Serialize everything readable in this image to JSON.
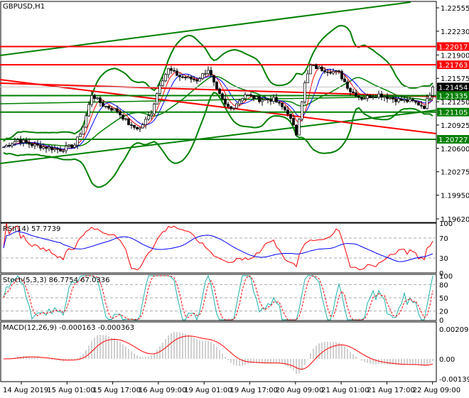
{
  "chart_data": {
    "type": "candlestick",
    "symbol_label": "GBPUSD,H1",
    "price_axis": {
      "ticks": [
        "1.22555",
        "1.22230",
        "1.21900",
        "1.21575",
        "1.21250",
        "1.20925",
        "1.20600",
        "1.20275",
        "1.19950",
        "1.19620"
      ],
      "range": [
        1.1962,
        1.22555
      ]
    },
    "levels": [
      {
        "label": "1.22017",
        "value": 1.22017,
        "color": "#ff0000"
      },
      {
        "label": "1.21763",
        "value": 1.21763,
        "color": "#ff0000"
      },
      {
        "label": "1.21454",
        "value": 1.21454,
        "color": "#000000",
        "current": true
      },
      {
        "label": "1.21335",
        "value": 1.21335,
        "color": "#008000"
      },
      {
        "label": "1.21105",
        "value": 1.21105,
        "color": "#008000"
      },
      {
        "label": "1.20727",
        "value": 1.20727,
        "color": "#008000"
      }
    ],
    "close_keypoints": [
      [
        0,
        1.2062
      ],
      [
        5,
        1.2072
      ],
      [
        10,
        1.2065
      ],
      [
        20,
        1.2058
      ],
      [
        25,
        1.2065
      ],
      [
        28,
        1.209
      ],
      [
        31,
        1.2135
      ],
      [
        35,
        1.212
      ],
      [
        40,
        1.2112
      ],
      [
        45,
        1.209
      ],
      [
        48,
        1.2088
      ],
      [
        52,
        1.211
      ],
      [
        55,
        1.215
      ],
      [
        58,
        1.217
      ],
      [
        62,
        1.216
      ],
      [
        68,
        1.2155
      ],
      [
        72,
        1.217
      ],
      [
        75,
        1.214
      ],
      [
        78,
        1.212
      ],
      [
        80,
        1.2115
      ],
      [
        85,
        1.2135
      ],
      [
        90,
        1.2128
      ],
      [
        95,
        1.2128
      ],
      [
        100,
        1.211
      ],
      [
        103,
        1.208
      ],
      [
        106,
        1.215
      ],
      [
        108,
        1.2175
      ],
      [
        112,
        1.217
      ],
      [
        118,
        1.2165
      ],
      [
        122,
        1.214
      ],
      [
        126,
        1.213
      ],
      [
        132,
        1.2135
      ],
      [
        138,
        1.2128
      ],
      [
        144,
        1.2125
      ],
      [
        148,
        1.2118
      ],
      [
        151,
        1.21454
      ]
    ],
    "time_labels": [
      "14 Aug 2019",
      "15 Aug 01:00",
      "15 Aug 17:00",
      "16 Aug 09:00",
      "19 Aug 01:00",
      "19 Aug 17:00",
      "20 Aug 09:00",
      "21 Aug 01:00",
      "21 Aug 17:00",
      "22 Aug 09:00"
    ],
    "rsi": {
      "label": "RSI(14) 57.7739",
      "ticks": [
        "100",
        "70",
        "30",
        "0"
      ]
    },
    "stoch": {
      "label": "Stoch(5,3,3) 86.7754 67.0336",
      "ticks": [
        "100",
        "80",
        "50",
        "20",
        "0"
      ]
    },
    "macd": {
      "label": "MACD(12,26,9) -0.000163 -0.000363",
      "ticks": [
        "0.002098",
        "0.00",
        "-0.00139"
      ]
    }
  }
}
